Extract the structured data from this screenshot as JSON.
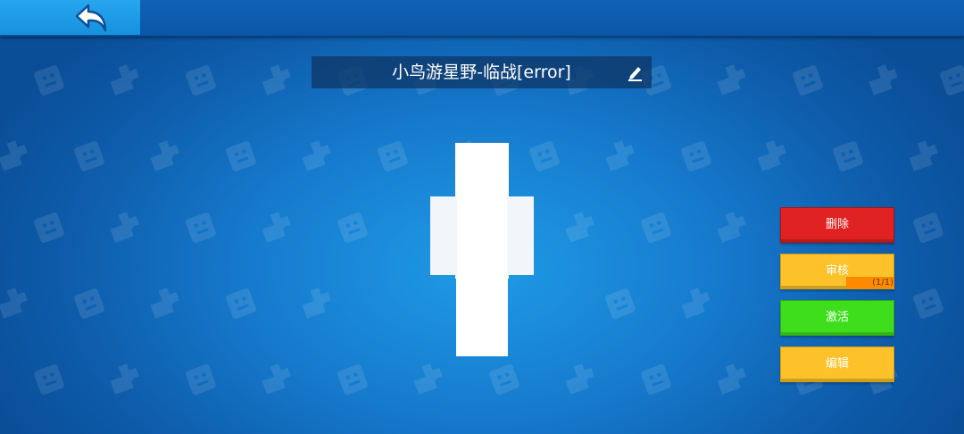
{
  "topbar": {
    "back_icon": "back-arrow-icon"
  },
  "profile": {
    "name": "小鸟游星野-临战[error]",
    "edit_icon": "pencil-icon"
  },
  "actions": {
    "delete_label": "删除",
    "review_label": "审核",
    "review_progress": "(1/1)",
    "activate_label": "激活",
    "edit_label": "编辑"
  },
  "colors": {
    "delete": "#e02222",
    "review": "#fdc22a",
    "review_progress_bar": "#ff8a00",
    "activate": "#3fde1c",
    "edit": "#fdc22a",
    "background": "#1679cc",
    "topbar": "#0b56a6",
    "back_button": "#1691de"
  }
}
